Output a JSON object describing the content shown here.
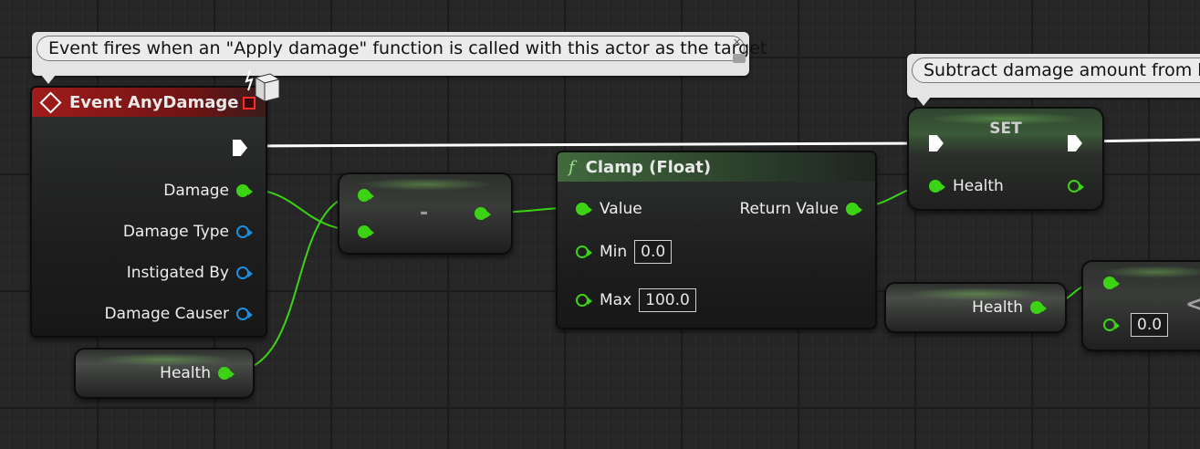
{
  "comments": {
    "apply_damage": "Event fires when an \"Apply damage\" function is called with this actor as the target",
    "subtract": "Subtract damage amount from hea"
  },
  "event_node": {
    "title": "Event AnyDamage",
    "pins": {
      "damage": "Damage",
      "damage_type": "Damage Type",
      "instigated_by": "Instigated By",
      "damage_causer": "Damage Causer"
    }
  },
  "health_getter_left": {
    "label": "Health"
  },
  "subtract_node": {
    "symbol": "-"
  },
  "clamp_node": {
    "title": "Clamp (Float)",
    "func_icon": "f",
    "value_label": "Value",
    "return_label": "Return Value",
    "min_label": "Min",
    "min_value": "0.0",
    "max_label": "Max",
    "max_value": "100.0"
  },
  "set_node": {
    "title": "SET",
    "pin_label": "Health"
  },
  "health_getter_right": {
    "label": "Health"
  },
  "compare_node": {
    "value": "0.0",
    "symbol": "<"
  },
  "colors": {
    "float_pin": "#3cd315",
    "struct_pin": "#1e8fe0",
    "event_header": "#a01b1b",
    "exec_wire": "#ffffff"
  }
}
